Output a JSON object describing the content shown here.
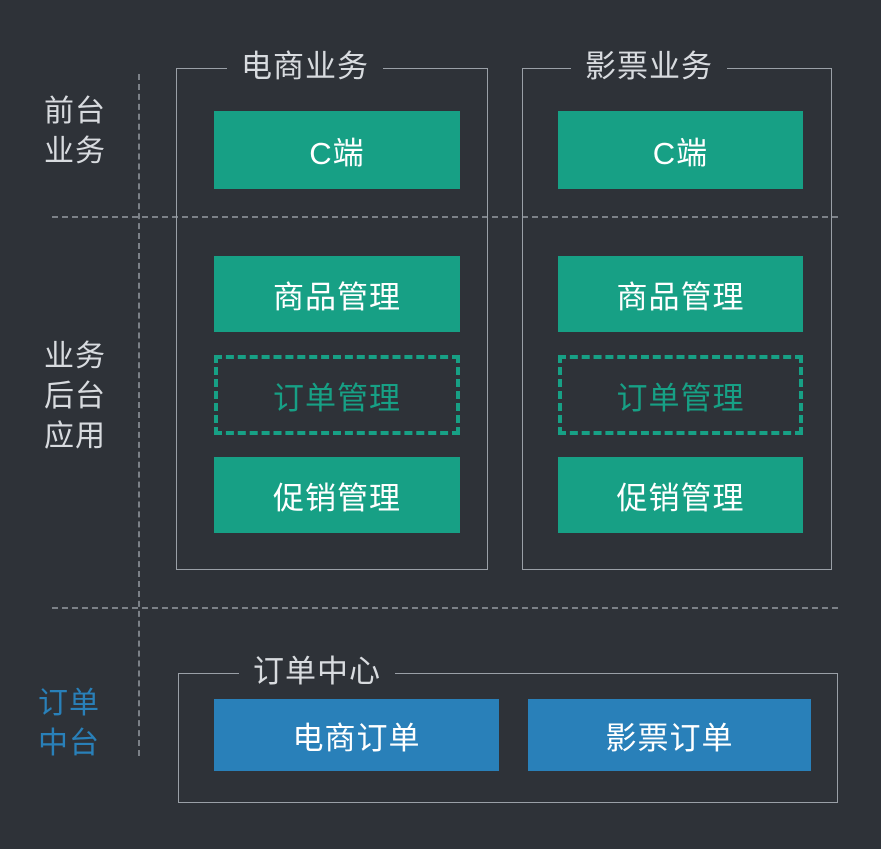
{
  "diagram": {
    "title_semantics": "business-architecture-layers",
    "background_color": "#2e3238",
    "colors": {
      "green": "#17a085",
      "blue": "#2980b9",
      "line": "#9aa0a7",
      "text": "#d8dbdf"
    }
  },
  "row_labels": [
    {
      "id": "front-office",
      "text": "前台\n业务",
      "color": "#d8dbdf"
    },
    {
      "id": "business-backend",
      "text": "业务\n后台\n应用",
      "color": "#d8dbdf"
    },
    {
      "id": "order-midplatform",
      "text": "订单\n中台",
      "color": "#2980b9"
    }
  ],
  "columns": {
    "ecommerce": {
      "title": "电商业务"
    },
    "movie_ticket": {
      "title": "影票业务"
    }
  },
  "front_office": {
    "ecommerce": {
      "label": "C端"
    },
    "movie_ticket": {
      "label": "C端"
    }
  },
  "business_backend": {
    "ecommerce": [
      {
        "label": "商品管理",
        "style": "green"
      },
      {
        "label": "订单管理",
        "style": "dashed"
      },
      {
        "label": "促销管理",
        "style": "green"
      }
    ],
    "movie_ticket": [
      {
        "label": "商品管理",
        "style": "green"
      },
      {
        "label": "订单管理",
        "style": "dashed"
      },
      {
        "label": "促销管理",
        "style": "green"
      }
    ]
  },
  "order_center": {
    "title": "订单中心",
    "items": [
      {
        "label": "电商订单",
        "style": "blue"
      },
      {
        "label": "影票订单",
        "style": "blue"
      }
    ]
  }
}
